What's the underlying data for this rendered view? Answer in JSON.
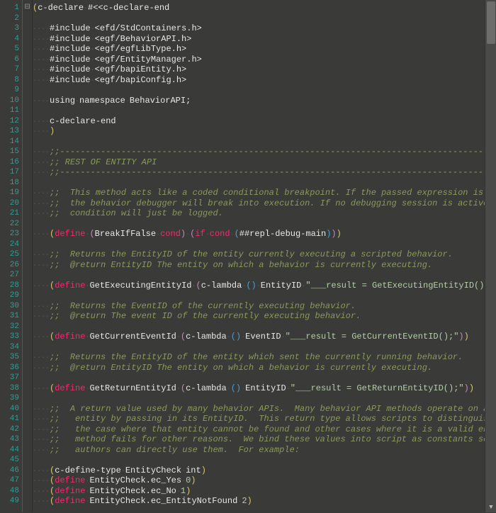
{
  "editor": {
    "first_line": 1,
    "last_line": 49,
    "lines": [
      {
        "n": 1,
        "fold": "⊟",
        "segs": [
          [
            "c-yellow",
            "("
          ],
          [
            "c-def",
            "c-declare"
          ],
          [
            "c-ws",
            " "
          ],
          [
            "c-def",
            "#<<c-declare-end"
          ]
        ]
      },
      {
        "n": 2,
        "segs": []
      },
      {
        "n": 3,
        "segs": [
          [
            "c-def",
            "#include"
          ],
          [
            "c-ws",
            " "
          ],
          [
            "c-def",
            "<efd/StdContainers.h>"
          ]
        ]
      },
      {
        "n": 4,
        "segs": [
          [
            "c-def",
            "#include"
          ],
          [
            "c-ws",
            " "
          ],
          [
            "c-def",
            "<egf/BehaviorAPI.h>"
          ]
        ]
      },
      {
        "n": 5,
        "segs": [
          [
            "c-def",
            "#include"
          ],
          [
            "c-ws",
            " "
          ],
          [
            "c-def",
            "<egf/egfLibType.h>"
          ]
        ]
      },
      {
        "n": 6,
        "segs": [
          [
            "c-def",
            "#include"
          ],
          [
            "c-ws",
            " "
          ],
          [
            "c-def",
            "<egf/EntityManager.h>"
          ]
        ]
      },
      {
        "n": 7,
        "segs": [
          [
            "c-def",
            "#include"
          ],
          [
            "c-ws",
            " "
          ],
          [
            "c-def",
            "<egf/bapiEntity.h>"
          ]
        ]
      },
      {
        "n": 8,
        "segs": [
          [
            "c-def",
            "#include"
          ],
          [
            "c-ws",
            " "
          ],
          [
            "c-def",
            "<egf/bapiConfig.h>"
          ]
        ]
      },
      {
        "n": 9,
        "segs": []
      },
      {
        "n": 10,
        "segs": [
          [
            "c-def",
            "using"
          ],
          [
            "c-ws",
            " "
          ],
          [
            "c-def",
            "namespace"
          ],
          [
            "c-ws",
            " "
          ],
          [
            "c-def",
            "BehaviorAPI;"
          ]
        ]
      },
      {
        "n": 11,
        "segs": []
      },
      {
        "n": 12,
        "segs": [
          [
            "c-def",
            "c-declare-end"
          ]
        ]
      },
      {
        "n": 13,
        "segs": [
          [
            "c-yellow",
            ")"
          ]
        ]
      },
      {
        "n": 14,
        "segs": []
      },
      {
        "n": 15,
        "segs": [
          [
            "c-comment",
            ";;------------------------------------------------------------------------------------------"
          ]
        ]
      },
      {
        "n": 16,
        "segs": [
          [
            "c-comment",
            ";; REST OF ENTITY API"
          ]
        ]
      },
      {
        "n": 17,
        "segs": [
          [
            "c-comment",
            ";;------------------------------------------------------------------------------------------"
          ]
        ]
      },
      {
        "n": 18,
        "segs": []
      },
      {
        "n": 19,
        "segs": [
          [
            "c-comment",
            ";;  This method acts like a coded conditional breakpoint. If the passed expression is false,"
          ]
        ]
      },
      {
        "n": 20,
        "segs": [
          [
            "c-comment",
            ";;  the behavior debugger will break into execution. If no debugging session is active, the"
          ]
        ]
      },
      {
        "n": 21,
        "segs": [
          [
            "c-comment",
            ";;  condition will just be logged."
          ]
        ]
      },
      {
        "n": 22,
        "segs": []
      },
      {
        "n": 23,
        "segs": [
          [
            "c-yellow",
            "("
          ],
          [
            "c-kw",
            "define"
          ],
          [
            "c-ws",
            " "
          ],
          [
            "c-purple",
            "("
          ],
          [
            "c-def",
            "BreakIfFalse"
          ],
          [
            "c-ws",
            " "
          ],
          [
            "c-kw",
            "cond"
          ],
          [
            "c-purple",
            ")"
          ],
          [
            "c-ws",
            " "
          ],
          [
            "c-purple",
            "("
          ],
          [
            "c-kw",
            "if"
          ],
          [
            "c-ws",
            " "
          ],
          [
            "c-kw",
            "cond"
          ],
          [
            "c-ws",
            " "
          ],
          [
            "c-blue",
            "("
          ],
          [
            "c-def",
            "##repl-debug-main"
          ],
          [
            "c-blue",
            ")"
          ],
          [
            "c-purple",
            ")"
          ],
          [
            "c-yellow",
            ")"
          ]
        ]
      },
      {
        "n": 24,
        "segs": []
      },
      {
        "n": 25,
        "segs": [
          [
            "c-comment",
            ";;  Returns the EntityID of the entity currently executing a scripted behavior."
          ]
        ]
      },
      {
        "n": 26,
        "segs": [
          [
            "c-comment",
            ";;  @return EntityID The entity on which a behavior is currently executing."
          ]
        ]
      },
      {
        "n": 27,
        "segs": []
      },
      {
        "n": 28,
        "segs": [
          [
            "c-yellow",
            "("
          ],
          [
            "c-kw",
            "define"
          ],
          [
            "c-ws",
            " "
          ],
          [
            "c-def",
            "GetExecutingEntityId"
          ],
          [
            "c-ws",
            " "
          ],
          [
            "c-purple",
            "("
          ],
          [
            "c-def",
            "c-lambda"
          ],
          [
            "c-ws",
            " "
          ],
          [
            "c-blue",
            "("
          ],
          [
            "c-blue",
            ")"
          ],
          [
            "c-ws",
            " "
          ],
          [
            "c-def",
            "EntityID"
          ],
          [
            "c-ws",
            " "
          ],
          [
            "c-str",
            "\"___result = GetExecutingEntityID();\""
          ],
          [
            "c-purple",
            ")"
          ],
          [
            "c-yellow",
            ")"
          ]
        ]
      },
      {
        "n": 29,
        "segs": []
      },
      {
        "n": 30,
        "segs": [
          [
            "c-comment",
            ";;  Returns the EventID of the currently executing behavior."
          ]
        ]
      },
      {
        "n": 31,
        "segs": [
          [
            "c-comment",
            ";;  @return The event ID of the currently executing behavior."
          ]
        ]
      },
      {
        "n": 32,
        "segs": []
      },
      {
        "n": 33,
        "segs": [
          [
            "c-yellow",
            "("
          ],
          [
            "c-kw",
            "define"
          ],
          [
            "c-ws",
            " "
          ],
          [
            "c-def",
            "GetCurrentEventId"
          ],
          [
            "c-ws",
            " "
          ],
          [
            "c-purple",
            "("
          ],
          [
            "c-def",
            "c-lambda"
          ],
          [
            "c-ws",
            " "
          ],
          [
            "c-blue",
            "("
          ],
          [
            "c-blue",
            ")"
          ],
          [
            "c-ws",
            " "
          ],
          [
            "c-def",
            "EventID"
          ],
          [
            "c-ws",
            " "
          ],
          [
            "c-str",
            "\"___result = GetCurrentEventID();\""
          ],
          [
            "c-purple",
            ")"
          ],
          [
            "c-yellow",
            ")"
          ]
        ]
      },
      {
        "n": 34,
        "segs": []
      },
      {
        "n": 35,
        "segs": [
          [
            "c-comment",
            ";;  Returns the EntityID of the entity which sent the currently running behavior."
          ]
        ]
      },
      {
        "n": 36,
        "segs": [
          [
            "c-comment",
            ";;  @return EntityID The entity on which a behavior is currently executing."
          ]
        ]
      },
      {
        "n": 37,
        "segs": []
      },
      {
        "n": 38,
        "segs": [
          [
            "c-yellow",
            "("
          ],
          [
            "c-kw",
            "define"
          ],
          [
            "c-ws",
            " "
          ],
          [
            "c-def",
            "GetReturnEntityId"
          ],
          [
            "c-ws",
            " "
          ],
          [
            "c-purple",
            "("
          ],
          [
            "c-def",
            "c-lambda"
          ],
          [
            "c-ws",
            " "
          ],
          [
            "c-blue",
            "("
          ],
          [
            "c-blue",
            ")"
          ],
          [
            "c-ws",
            " "
          ],
          [
            "c-def",
            "EntityID"
          ],
          [
            "c-ws",
            " "
          ],
          [
            "c-str",
            "\"___result = GetReturnEntityID();\""
          ],
          [
            "c-purple",
            ")"
          ],
          [
            "c-yellow",
            ")"
          ]
        ]
      },
      {
        "n": 39,
        "segs": []
      },
      {
        "n": 40,
        "segs": [
          [
            "c-comment",
            ";;  A return value used by many behavior APIs.  Many behavior API methods operate on a specific"
          ]
        ]
      },
      {
        "n": 41,
        "segs": [
          [
            "c-comment",
            ";;   entity by passing in its EntityID.  This return type allows scripts to distinguish between"
          ]
        ]
      },
      {
        "n": 42,
        "segs": [
          [
            "c-comment",
            ";;   the case where that entity cannot be found and other cases where it is a valid entity but the"
          ]
        ]
      },
      {
        "n": 43,
        "segs": [
          [
            "c-comment",
            ";;   method fails for other reasons.  We bind these values into script as constants so script"
          ]
        ]
      },
      {
        "n": 44,
        "segs": [
          [
            "c-comment",
            ";;   authors can directly use them.  For example:"
          ]
        ]
      },
      {
        "n": 45,
        "segs": []
      },
      {
        "n": 46,
        "segs": [
          [
            "c-yellow",
            "("
          ],
          [
            "c-def",
            "c-define-type"
          ],
          [
            "c-ws",
            " "
          ],
          [
            "c-def",
            "EntityCheck"
          ],
          [
            "c-ws",
            " "
          ],
          [
            "c-def",
            "int"
          ],
          [
            "c-yellow",
            ")"
          ]
        ]
      },
      {
        "n": 47,
        "segs": [
          [
            "c-yellow",
            "("
          ],
          [
            "c-kw",
            "define"
          ],
          [
            "c-ws",
            " "
          ],
          [
            "c-def",
            "EntityCheck.ec_Yes"
          ],
          [
            "c-ws",
            " "
          ],
          [
            "c-num",
            "0"
          ],
          [
            "c-yellow",
            ")"
          ]
        ]
      },
      {
        "n": 48,
        "segs": [
          [
            "c-yellow",
            "("
          ],
          [
            "c-kw",
            "define"
          ],
          [
            "c-ws",
            " "
          ],
          [
            "c-def",
            "EntityCheck.ec_No"
          ],
          [
            "c-ws",
            " "
          ],
          [
            "c-num",
            "1"
          ],
          [
            "c-yellow",
            ")"
          ]
        ]
      },
      {
        "n": 49,
        "segs": [
          [
            "c-yellow",
            "("
          ],
          [
            "c-kw",
            "define"
          ],
          [
            "c-ws",
            " "
          ],
          [
            "c-def",
            "EntityCheck.ec_EntityNotFound"
          ],
          [
            "c-ws",
            " "
          ],
          [
            "c-num",
            "2"
          ],
          [
            "c-yellow",
            ")"
          ]
        ]
      }
    ]
  }
}
